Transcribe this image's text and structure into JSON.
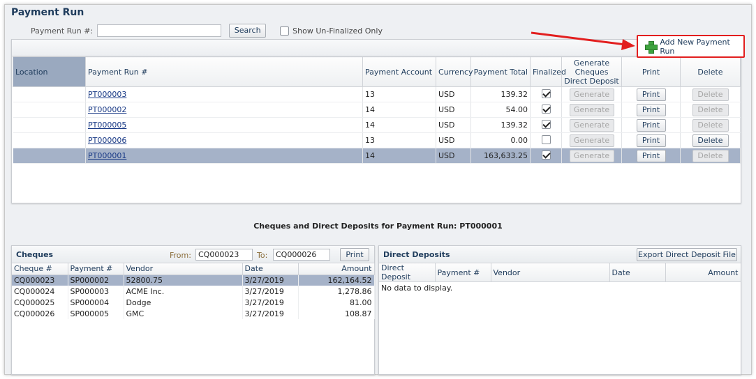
{
  "page": {
    "title": "Payment Run",
    "payment_run_label": "Payment Run #:",
    "payment_run_value": "",
    "search_label": "Search",
    "show_unfinalized_label": "Show Un-Finalized Only",
    "add_new_label": "Add New Payment Run"
  },
  "payment_runs": {
    "columns": [
      "Location",
      "Payment Run #",
      "Payment Account",
      "Currency",
      "Payment Total",
      "Finalized",
      "Generate Cheques Direct Deposit",
      "Print",
      "Delete"
    ],
    "rows": [
      {
        "location": "",
        "run": "PT000003",
        "account": "13",
        "currency": "USD",
        "total": "139.32",
        "finalized": true,
        "generate": "Generate",
        "print": "Print",
        "delete": "Delete"
      },
      {
        "location": "",
        "run": "PT000002",
        "account": "14",
        "currency": "USD",
        "total": "54.00",
        "finalized": true,
        "generate": "Generate",
        "print": "Print",
        "delete": "Delete"
      },
      {
        "location": "",
        "run": "PT000005",
        "account": "14",
        "currency": "USD",
        "total": "139.32",
        "finalized": true,
        "generate": "Generate",
        "print": "Print",
        "delete": "Delete"
      },
      {
        "location": "",
        "run": "PT000006",
        "account": "13",
        "currency": "USD",
        "total": "0.00",
        "finalized": false,
        "generate": "Generate",
        "print": "Print",
        "delete": "Delete"
      },
      {
        "location": "",
        "run": "PT000001",
        "account": "14",
        "currency": "USD",
        "total": "163,633.25",
        "finalized": true,
        "generate": "Generate",
        "print": "Print",
        "delete": "Delete"
      }
    ]
  },
  "details_title": "Cheques and Direct Deposits for Payment Run: PT000001",
  "cheques": {
    "title": "Cheques",
    "from_label": "From:",
    "from_value": "CQ000023",
    "to_label": "To:",
    "to_value": "CQ000026",
    "print_label": "Print",
    "columns": [
      "Cheque #",
      "Payment #",
      "Vendor",
      "Date",
      "Amount"
    ],
    "rows": [
      {
        "cheque": "CQ000023",
        "payment": "SP000002",
        "vendor": "52800.75",
        "date": "3/27/2019",
        "amount": "162,164.52"
      },
      {
        "cheque": "CQ000024",
        "payment": "SP000003",
        "vendor": "ACME Inc.",
        "date": "3/27/2019",
        "amount": "1,278.86"
      },
      {
        "cheque": "CQ000025",
        "payment": "SP000004",
        "vendor": "Dodge",
        "date": "3/27/2019",
        "amount": "81.00"
      },
      {
        "cheque": "CQ000026",
        "payment": "SP000005",
        "vendor": "GMC",
        "date": "3/27/2019",
        "amount": "108.87"
      }
    ]
  },
  "direct_deposits": {
    "title": "Direct Deposits",
    "export_label": "Export Direct Deposit File",
    "columns": [
      "Direct Deposit",
      "Payment #",
      "Vendor",
      "Date",
      "Amount"
    ],
    "empty_text": "No data to display."
  },
  "colors": {
    "selected_row": "#a5b2c8",
    "callout": "#e21e1e",
    "title": "#1f3c5c"
  }
}
